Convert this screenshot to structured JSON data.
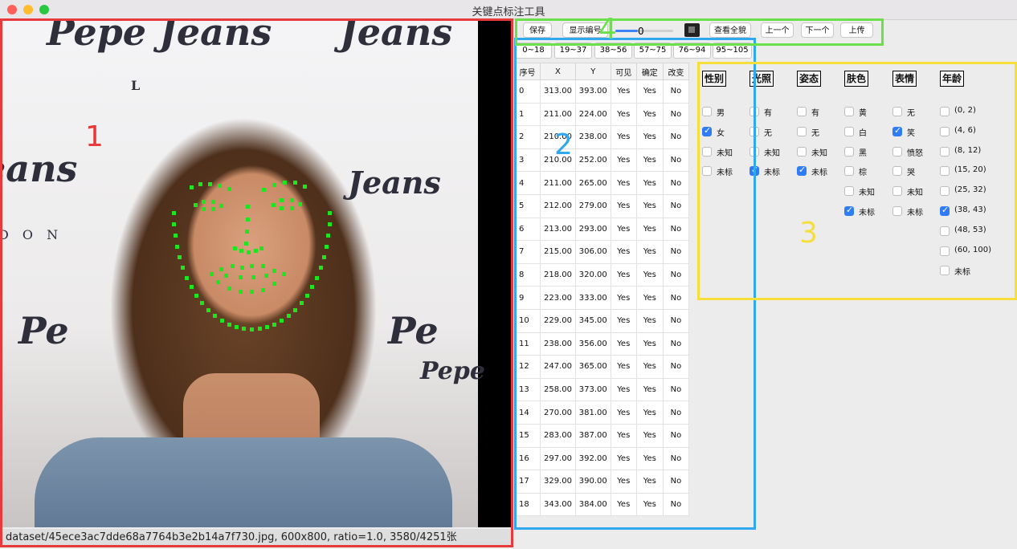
{
  "window": {
    "title": "关键点标注工具"
  },
  "photo": {
    "bg_words": [
      "Pepe Jeans",
      "Jeans",
      "eans",
      "Jeans",
      "L",
      "D O N",
      "Pe",
      "Pe",
      "Pepe"
    ]
  },
  "status": "dataset/45ece3ac7dde68a7764b3e2b14a7f730.jpg, 600x800, ratio=1.0, 3580/4251张",
  "regions": {
    "r1": "1",
    "r2": "2",
    "r3": "3",
    "r4": "4"
  },
  "toolbar": {
    "save": "保存",
    "show_index": "显示编号",
    "slider_value": "0",
    "view_all": "查看全貌",
    "prev": "上一个",
    "next": "下一个",
    "upload": "上传"
  },
  "ranges": [
    "0~18",
    "19~37",
    "38~56",
    "57~75",
    "76~94",
    "95~105"
  ],
  "table": {
    "headers": [
      "序号",
      "X",
      "Y",
      "可见",
      "确定",
      "改变"
    ],
    "rows": [
      [
        "0",
        "313.00",
        "393.00",
        "Yes",
        "Yes",
        "No"
      ],
      [
        "1",
        "211.00",
        "224.00",
        "Yes",
        "Yes",
        "No"
      ],
      [
        "2",
        "210.00",
        "238.00",
        "Yes",
        "Yes",
        "No"
      ],
      [
        "3",
        "210.00",
        "252.00",
        "Yes",
        "Yes",
        "No"
      ],
      [
        "4",
        "211.00",
        "265.00",
        "Yes",
        "Yes",
        "No"
      ],
      [
        "5",
        "212.00",
        "279.00",
        "Yes",
        "Yes",
        "No"
      ],
      [
        "6",
        "213.00",
        "293.00",
        "Yes",
        "Yes",
        "No"
      ],
      [
        "7",
        "215.00",
        "306.00",
        "Yes",
        "Yes",
        "No"
      ],
      [
        "8",
        "218.00",
        "320.00",
        "Yes",
        "Yes",
        "No"
      ],
      [
        "9",
        "223.00",
        "333.00",
        "Yes",
        "Yes",
        "No"
      ],
      [
        "10",
        "229.00",
        "345.00",
        "Yes",
        "Yes",
        "No"
      ],
      [
        "11",
        "238.00",
        "356.00",
        "Yes",
        "Yes",
        "No"
      ],
      [
        "12",
        "247.00",
        "365.00",
        "Yes",
        "Yes",
        "No"
      ],
      [
        "13",
        "258.00",
        "373.00",
        "Yes",
        "Yes",
        "No"
      ],
      [
        "14",
        "270.00",
        "381.00",
        "Yes",
        "Yes",
        "No"
      ],
      [
        "15",
        "283.00",
        "387.00",
        "Yes",
        "Yes",
        "No"
      ],
      [
        "16",
        "297.00",
        "392.00",
        "Yes",
        "Yes",
        "No"
      ],
      [
        "17",
        "329.00",
        "390.00",
        "Yes",
        "Yes",
        "No"
      ],
      [
        "18",
        "343.00",
        "384.00",
        "Yes",
        "Yes",
        "No"
      ]
    ]
  },
  "attributes": [
    {
      "title": "性别",
      "options": [
        {
          "label": "男",
          "checked": false
        },
        {
          "label": "女",
          "checked": true
        },
        {
          "label": "未知",
          "checked": false
        },
        {
          "label": "未标",
          "checked": false
        }
      ]
    },
    {
      "title": "光照",
      "options": [
        {
          "label": "有",
          "checked": false
        },
        {
          "label": "无",
          "checked": false
        },
        {
          "label": "未知",
          "checked": false
        },
        {
          "label": "未标",
          "checked": true
        }
      ]
    },
    {
      "title": "姿态",
      "options": [
        {
          "label": "有",
          "checked": false
        },
        {
          "label": "无",
          "checked": false
        },
        {
          "label": "未知",
          "checked": false
        },
        {
          "label": "未标",
          "checked": true
        }
      ]
    },
    {
      "title": "肤色",
      "options": [
        {
          "label": "黄",
          "checked": false
        },
        {
          "label": "白",
          "checked": false
        },
        {
          "label": "黑",
          "checked": false
        },
        {
          "label": "棕",
          "checked": false
        },
        {
          "label": "未知",
          "checked": false
        },
        {
          "label": "未标",
          "checked": true
        }
      ]
    },
    {
      "title": "表情",
      "options": [
        {
          "label": "无",
          "checked": false
        },
        {
          "label": "笑",
          "checked": true
        },
        {
          "label": "愤怒",
          "checked": false
        },
        {
          "label": "哭",
          "checked": false
        },
        {
          "label": "未知",
          "checked": false
        },
        {
          "label": "未标",
          "checked": false
        }
      ]
    },
    {
      "title": "年龄",
      "options": [
        {
          "label": "(0, 2)",
          "checked": false
        },
        {
          "label": "(4, 6)",
          "checked": false
        },
        {
          "label": "(8, 12)",
          "checked": false
        },
        {
          "label": "(15, 20)",
          "checked": false
        },
        {
          "label": "(25, 32)",
          "checked": false
        },
        {
          "label": "(38, 43)",
          "checked": true
        },
        {
          "label": "(48, 53)",
          "checked": false
        },
        {
          "label": "(60, 100)",
          "checked": false
        },
        {
          "label": "未标",
          "checked": false
        }
      ]
    }
  ],
  "colors": {
    "accent": "#2f7cf6",
    "keypoint": "#1ee61e",
    "region1": "#e8393b",
    "region2": "#2fa8ef",
    "region3": "#f6de3b",
    "region4": "#6be04a"
  }
}
